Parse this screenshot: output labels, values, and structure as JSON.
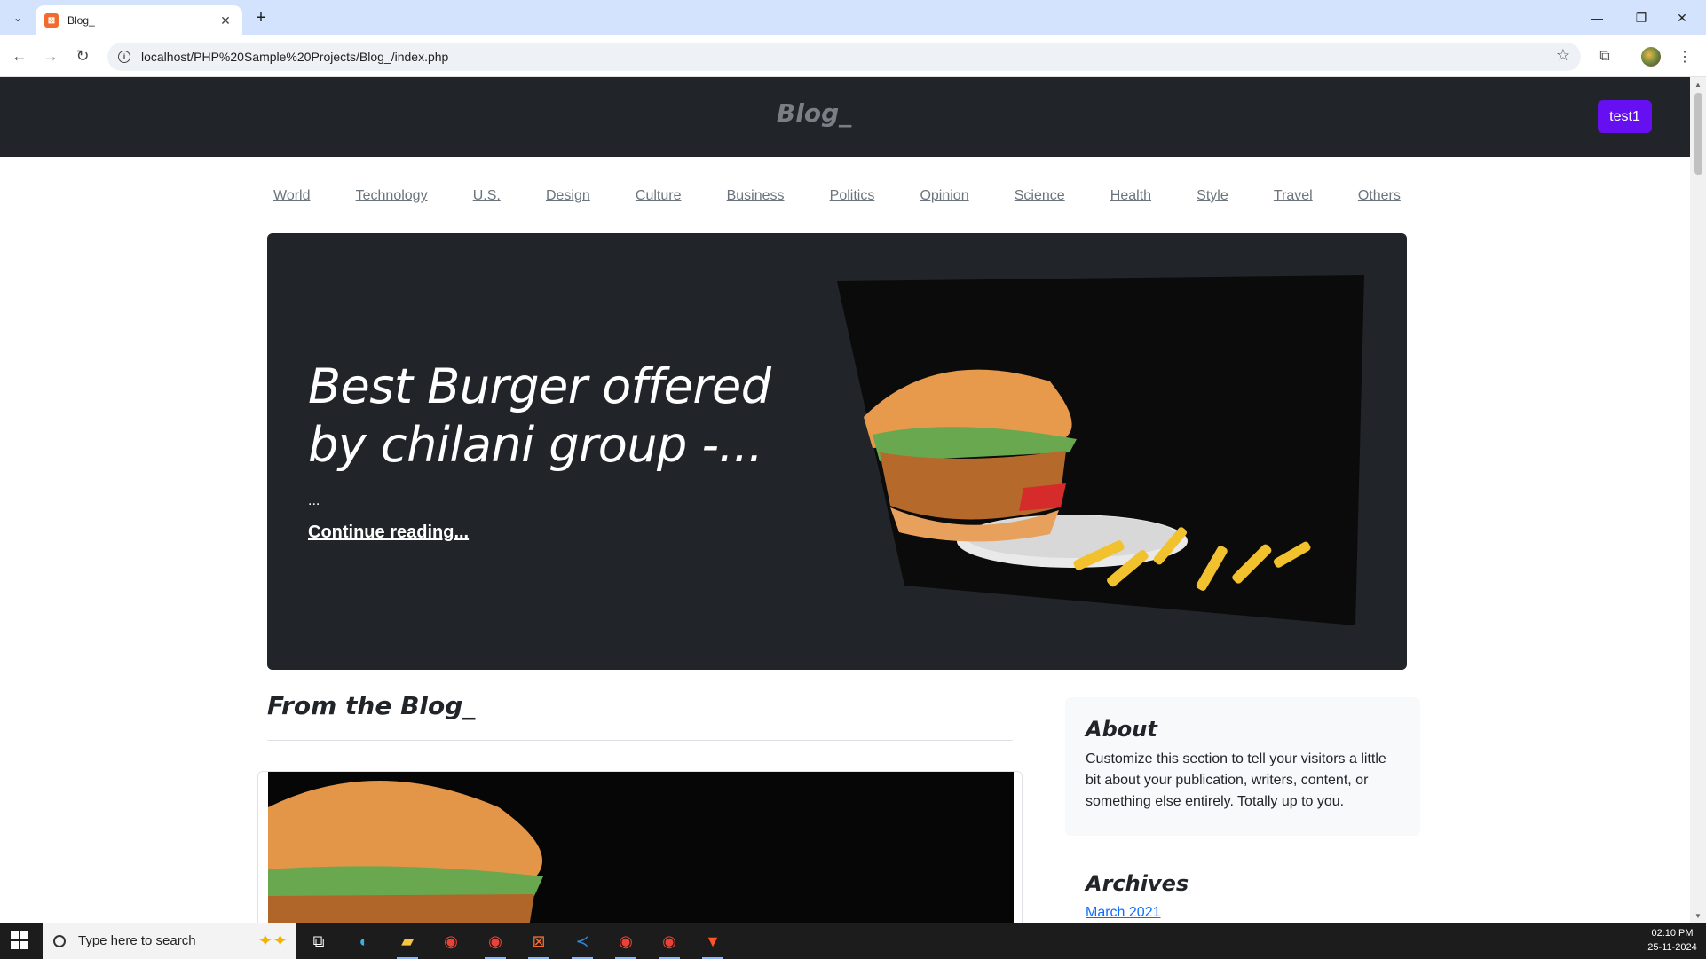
{
  "browser": {
    "tab_title": "Blog_",
    "tab_favicon": "xampp-icon",
    "url": "localhost/PHP%20Sample%20Projects/Blog_/index.php"
  },
  "site": {
    "brand": "Blog_",
    "user_button": "test1",
    "categories": [
      "World",
      "Technology",
      "U.S.",
      "Design",
      "Culture",
      "Business",
      "Politics",
      "Opinion",
      "Science",
      "Health",
      "Style",
      "Travel",
      "Others"
    ]
  },
  "hero": {
    "title": "Best Burger offered by chilani group -...",
    "excerpt": "...",
    "link": "Continue reading..."
  },
  "main": {
    "heading": "From the Blog_"
  },
  "sidebar": {
    "about_title": "About",
    "about_text": "Customize this section to tell your visitors a little bit about your publication, writers, content, or something else entirely. Totally up to you.",
    "archives_title": "Archives",
    "archives": [
      "March 2021"
    ]
  },
  "taskbar": {
    "search_placeholder": "Type here to search",
    "time": "02:10 PM",
    "date": "25-11-2024"
  },
  "colors": {
    "header_bg": "#212529",
    "accent_button": "#6610f2",
    "link": "#0d6efd",
    "tabbar_bg": "#d3e3fd"
  }
}
